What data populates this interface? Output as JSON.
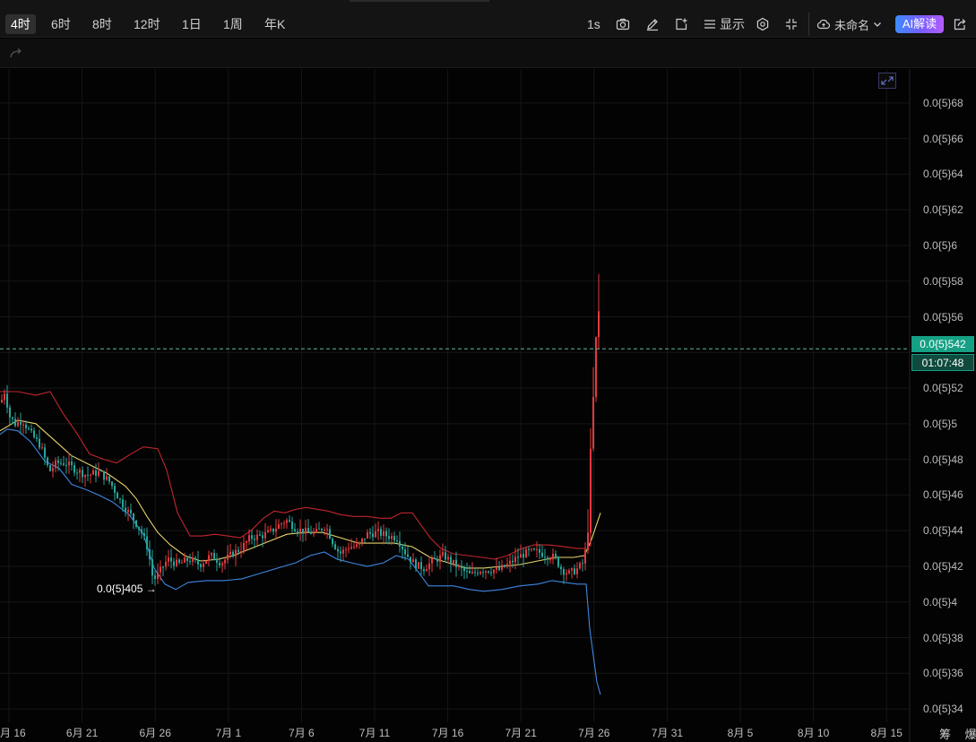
{
  "toolbar": {
    "intervals": [
      "4时",
      "6时",
      "8时",
      "12时",
      "1日",
      "1周",
      "年K"
    ],
    "active_interval": "4时",
    "speed_label": "1s",
    "display_label": "显示",
    "layout_name": "未命名",
    "ai_label": "AI解读",
    "icons": [
      "camera-icon",
      "pencil-icon",
      "add-indicator-icon",
      "list-icon",
      "settings-icon",
      "collapse-icon",
      "cloud-icon",
      "chevron-down-icon",
      "share-icon",
      "redo-icon",
      "expand-icon"
    ]
  },
  "price_axis": {
    "ticks": [
      "0.0{5}68",
      "0.0{5}66",
      "0.0{5}64",
      "0.0{5}62",
      "0.0{5}6",
      "0.0{5}58",
      "0.0{5}56",
      "0.0{5}52",
      "0.0{5}5",
      "0.0{5}48",
      "0.0{5}46",
      "0.0{5}44",
      "0.0{5}42",
      "0.0{5}4",
      "0.0{5}38",
      "0.0{5}36",
      "0.0{5}34"
    ],
    "current_price": "0.0{5}542",
    "countdown": "01:07:48"
  },
  "time_axis": {
    "ticks": [
      "月 16",
      "6月 21",
      "6月 26",
      "7月 1",
      "7月 6",
      "7月 11",
      "7月 16",
      "7月 21",
      "7月 26",
      "7月 31",
      "8月 5",
      "8月 10",
      "8月 15"
    ]
  },
  "annotations": {
    "low_label": "0.0{5}405 →",
    "corner_label": "筹 爆"
  },
  "colors": {
    "up": "#e5393f",
    "down": "#26a69a",
    "upper_band": "#c0262d",
    "middle_band": "#e6d36b",
    "lower_band": "#3e86e0",
    "accent": "#16a085"
  },
  "chart_data": {
    "type": "candlestick",
    "indicator": "bollinger-bands",
    "price_unit": "price = 0.00000 + value × 1e-7 (value shown in units of 0.0{5})",
    "y_range": [
      33.4,
      69.4
    ],
    "x_range": [
      "6月 16",
      "8月 15"
    ],
    "current_price": 54.2,
    "low_marked": 40.5,
    "price_path": [
      [
        0,
        51.2
      ],
      [
        4,
        51.8
      ],
      [
        10,
        50.4
      ],
      [
        16,
        50.0
      ],
      [
        24,
        50.2
      ],
      [
        34,
        49.4
      ],
      [
        44,
        48.8
      ],
      [
        54,
        47.3
      ],
      [
        62,
        47.8
      ],
      [
        72,
        47.8
      ],
      [
        84,
        47.4
      ],
      [
        96,
        47.1
      ],
      [
        110,
        47.3
      ],
      [
        122,
        46.7
      ],
      [
        134,
        45.6
      ],
      [
        146,
        44.8
      ],
      [
        156,
        44.0
      ],
      [
        164,
        43.0
      ],
      [
        170,
        41.2
      ],
      [
        176,
        41.6
      ],
      [
        186,
        42.4
      ],
      [
        198,
        42.1
      ],
      [
        210,
        42.4
      ],
      [
        222,
        42.1
      ],
      [
        234,
        42.6
      ],
      [
        246,
        42.2
      ],
      [
        258,
        42.7
      ],
      [
        268,
        43.0
      ],
      [
        278,
        43.6
      ],
      [
        290,
        43.7
      ],
      [
        300,
        43.9
      ],
      [
        310,
        44.3
      ],
      [
        318,
        44.6
      ],
      [
        330,
        44.1
      ],
      [
        342,
        43.9
      ],
      [
        352,
        43.9
      ],
      [
        362,
        44.3
      ],
      [
        370,
        43.4
      ],
      [
        378,
        42.7
      ],
      [
        388,
        43.1
      ],
      [
        398,
        43.1
      ],
      [
        408,
        43.8
      ],
      [
        420,
        43.9
      ],
      [
        432,
        43.7
      ],
      [
        442,
        43.6
      ],
      [
        452,
        42.7
      ],
      [
        462,
        42.1
      ],
      [
        472,
        41.9
      ],
      [
        482,
        42.3
      ],
      [
        494,
        42.6
      ],
      [
        504,
        42.2
      ],
      [
        514,
        41.8
      ],
      [
        524,
        41.5
      ],
      [
        534,
        41.8
      ],
      [
        546,
        41.8
      ],
      [
        556,
        41.8
      ],
      [
        566,
        42.1
      ],
      [
        576,
        42.5
      ],
      [
        588,
        42.8
      ],
      [
        600,
        42.8
      ],
      [
        610,
        42.6
      ],
      [
        618,
        42.5
      ],
      [
        626,
        41.8
      ],
      [
        634,
        41.6
      ],
      [
        642,
        41.8
      ],
      [
        650,
        42.2
      ],
      [
        654,
        43.4
      ],
      [
        656,
        45.5
      ],
      [
        658,
        48.0
      ],
      [
        660,
        50.5
      ],
      [
        662,
        52.0
      ],
      [
        664,
        54.5
      ],
      [
        666,
        56.0
      ],
      [
        668,
        56.4
      ],
      [
        670,
        55.2
      ]
    ],
    "bollinger": {
      "upper": [
        [
          0,
          51.8
        ],
        [
          20,
          51.8
        ],
        [
          40,
          51.6
        ],
        [
          56,
          51.8
        ],
        [
          70,
          50.6
        ],
        [
          84,
          49.6
        ],
        [
          100,
          48.3
        ],
        [
          116,
          48.0
        ],
        [
          130,
          47.8
        ],
        [
          146,
          48.3
        ],
        [
          160,
          48.7
        ],
        [
          176,
          48.6
        ],
        [
          186,
          47.4
        ],
        [
          198,
          45.0
        ],
        [
          212,
          43.7
        ],
        [
          226,
          43.7
        ],
        [
          240,
          43.8
        ],
        [
          254,
          43.7
        ],
        [
          268,
          43.6
        ],
        [
          280,
          44.0
        ],
        [
          294,
          44.7
        ],
        [
          306,
          45.1
        ],
        [
          318,
          45.0
        ],
        [
          330,
          45.2
        ],
        [
          342,
          45.3
        ],
        [
          354,
          45.2
        ],
        [
          366,
          45.1
        ],
        [
          380,
          44.9
        ],
        [
          394,
          44.8
        ],
        [
          410,
          44.8
        ],
        [
          424,
          44.7
        ],
        [
          436,
          44.7
        ],
        [
          448,
          45.0
        ],
        [
          460,
          45.0
        ],
        [
          470,
          44.3
        ],
        [
          480,
          43.6
        ],
        [
          492,
          43.0
        ],
        [
          506,
          42.7
        ],
        [
          522,
          42.6
        ],
        [
          538,
          42.5
        ],
        [
          552,
          42.4
        ],
        [
          566,
          42.6
        ],
        [
          582,
          43.0
        ],
        [
          596,
          43.2
        ],
        [
          612,
          43.2
        ],
        [
          630,
          43.1
        ],
        [
          644,
          43.0
        ],
        [
          654,
          43.0
        ]
      ],
      "middle": [
        [
          0,
          49.6
        ],
        [
          20,
          50.2
        ],
        [
          40,
          50.0
        ],
        [
          60,
          49.1
        ],
        [
          80,
          48.2
        ],
        [
          100,
          47.7
        ],
        [
          120,
          47.2
        ],
        [
          140,
          46.5
        ],
        [
          152,
          45.8
        ],
        [
          164,
          44.8
        ],
        [
          176,
          43.9
        ],
        [
          190,
          43.2
        ],
        [
          206,
          42.6
        ],
        [
          224,
          42.3
        ],
        [
          244,
          42.4
        ],
        [
          260,
          42.6
        ],
        [
          280,
          43.0
        ],
        [
          300,
          43.4
        ],
        [
          320,
          43.8
        ],
        [
          340,
          43.9
        ],
        [
          360,
          43.9
        ],
        [
          380,
          43.6
        ],
        [
          400,
          43.3
        ],
        [
          420,
          43.3
        ],
        [
          440,
          43.3
        ],
        [
          460,
          43.1
        ],
        [
          480,
          42.5
        ],
        [
          500,
          42.2
        ],
        [
          520,
          41.9
        ],
        [
          540,
          41.9
        ],
        [
          560,
          42.0
        ],
        [
          580,
          42.1
        ],
        [
          600,
          42.3
        ],
        [
          620,
          42.5
        ],
        [
          640,
          42.5
        ],
        [
          652,
          42.6
        ],
        [
          660,
          43.5
        ],
        [
          670,
          45.0
        ]
      ],
      "lower": [
        [
          0,
          49.4
        ],
        [
          8,
          49.7
        ],
        [
          20,
          49.6
        ],
        [
          34,
          49.0
        ],
        [
          50,
          47.9
        ],
        [
          66,
          47.5
        ],
        [
          80,
          46.6
        ],
        [
          96,
          46.3
        ],
        [
          110,
          46.0
        ],
        [
          126,
          45.6
        ],
        [
          144,
          44.9
        ],
        [
          160,
          43.8
        ],
        [
          172,
          41.9
        ],
        [
          184,
          41.0
        ],
        [
          196,
          40.7
        ],
        [
          210,
          41.1
        ],
        [
          230,
          41.2
        ],
        [
          250,
          41.2
        ],
        [
          270,
          41.3
        ],
        [
          290,
          41.6
        ],
        [
          310,
          41.9
        ],
        [
          330,
          42.2
        ],
        [
          346,
          42.6
        ],
        [
          362,
          42.8
        ],
        [
          376,
          42.4
        ],
        [
          392,
          42.2
        ],
        [
          410,
          42.0
        ],
        [
          428,
          42.2
        ],
        [
          442,
          42.6
        ],
        [
          456,
          42.4
        ],
        [
          468,
          41.6
        ],
        [
          478,
          40.9
        ],
        [
          490,
          40.9
        ],
        [
          506,
          40.9
        ],
        [
          524,
          40.7
        ],
        [
          540,
          40.6
        ],
        [
          560,
          40.7
        ],
        [
          580,
          40.9
        ],
        [
          600,
          41.0
        ],
        [
          616,
          41.2
        ],
        [
          630,
          41.1
        ],
        [
          644,
          41.0
        ],
        [
          654,
          41.0
        ],
        [
          658,
          38.5
        ],
        [
          662,
          37.0
        ],
        [
          666,
          35.5
        ],
        [
          670,
          34.8
        ]
      ]
    },
    "grid": true
  }
}
